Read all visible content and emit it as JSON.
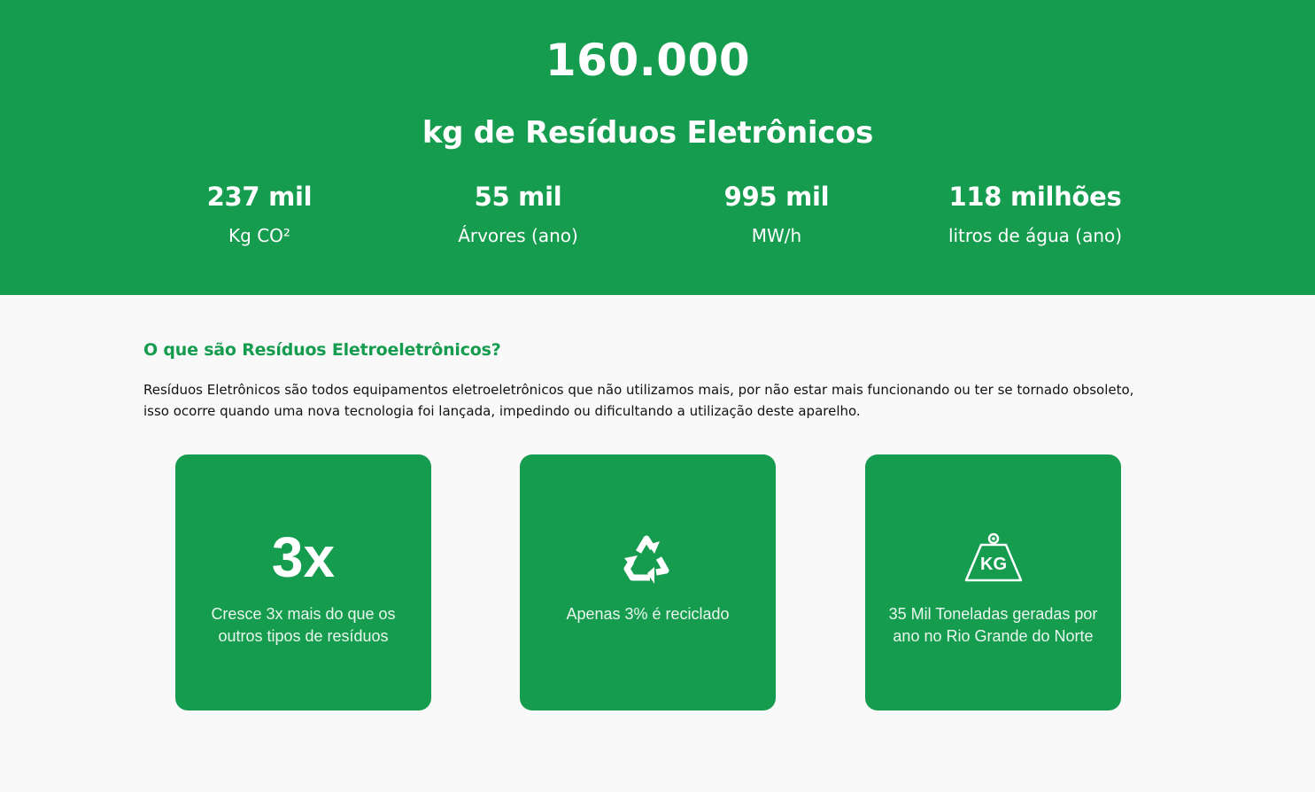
{
  "hero": {
    "number": "160.000",
    "subtitle": "kg de Resíduos Eletrônicos",
    "stats": [
      {
        "value": "237 mil",
        "label": "Kg CO²"
      },
      {
        "value": "55 mil",
        "label": "Árvores (ano)"
      },
      {
        "value": "995 mil",
        "label": "MW/h"
      },
      {
        "value": "118 milhões",
        "label": "litros de água (ano)"
      }
    ]
  },
  "section": {
    "title": "O que são Resíduos Eletroeletrônicos?",
    "text": "Resíduos Eletrônicos são todos equipamentos eletroeletrônicos que não utilizamos mais, por não estar mais funcionando ou ter se tornado obsoleto, isso ocorre quando uma nova tecnologia foi lançada, impedindo ou dificultando a utilização deste aparelho."
  },
  "cards": [
    {
      "big": "3x",
      "text": "Cresce 3x mais do que os outros tipos de resíduos"
    },
    {
      "icon": "recycle-icon",
      "text": "Apenas 3% é reciclado"
    },
    {
      "icon": "kg-weight-icon",
      "icon_text": "KG",
      "text": "35 Mil Toneladas geradas por ano no Rio Grande do Norte"
    }
  ],
  "colors": {
    "brand_green": "#169c4f",
    "page_background": "#f9f9f9",
    "text_dark": "#111111"
  }
}
